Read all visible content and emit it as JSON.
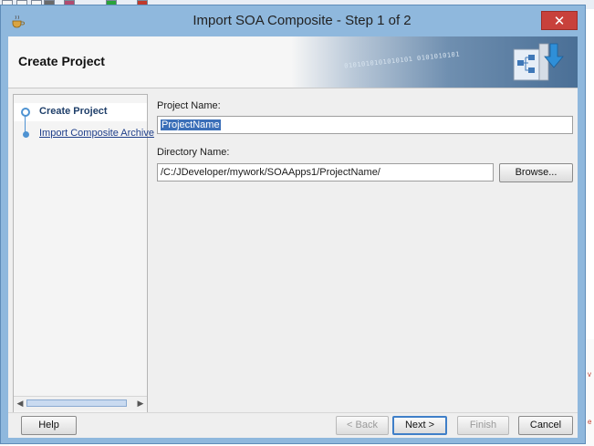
{
  "window": {
    "title": "Import SOA Composite - Step 1 of 2",
    "close_glyph": "✕"
  },
  "header": {
    "title": "Create Project",
    "binary_text": "0101010101010101 0101010101"
  },
  "steps": [
    {
      "label": "Create Project",
      "active": true
    },
    {
      "label": "Import Composite Archive",
      "active": false
    }
  ],
  "form": {
    "project_name_label": "Project Name:",
    "project_name_value": "ProjectName",
    "directory_name_label": "Directory Name:",
    "directory_name_value": "/C:/JDeveloper/mywork/SOAApps1/ProjectName/",
    "browse_label": "Browse..."
  },
  "buttons": {
    "help": "Help",
    "back": "< Back",
    "next": "Next >",
    "finish": "Finish",
    "cancel": "Cancel"
  },
  "colors": {
    "title_bar": "#8fb8dd",
    "close_button": "#c8413b",
    "selection": "#3b6fb8",
    "step_accent": "#4f93d2"
  }
}
